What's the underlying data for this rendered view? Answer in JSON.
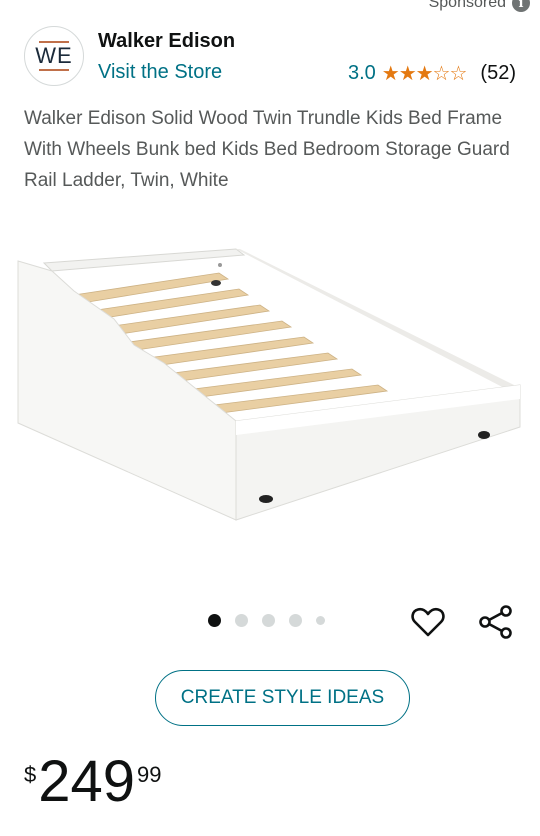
{
  "sponsored_label": "Sponsored",
  "brand": {
    "logo_text": "WE",
    "name": "Walker Edison",
    "store_link": "Visit the Store"
  },
  "rating": {
    "value": "3.0",
    "stars": "★★★☆☆",
    "star_value": 3,
    "count": "(52)",
    "star_color": "#e47911"
  },
  "product_title": "Walker Edison Solid Wood Twin Trundle Kids Bed Frame With Wheels Bunk bed Kids Bed Bedroom Storage Guard Rail Ladder, Twin, White",
  "carousel": {
    "total_dots": 5,
    "active_index": 0
  },
  "actions": {
    "favorite_icon": "heart-icon",
    "share_icon": "share-icon"
  },
  "create_button_label": "CREATE STYLE IDEAS",
  "price": {
    "symbol": "$",
    "whole": "249",
    "fraction": "99"
  },
  "colors": {
    "link": "#007185",
    "text_secondary": "#565959"
  }
}
